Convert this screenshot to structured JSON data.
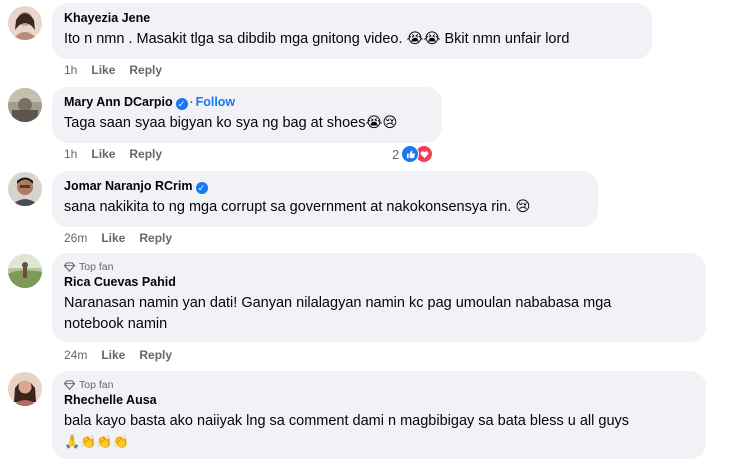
{
  "comments": [
    {
      "name": "Khayezia Jene",
      "text": "Ito n nmn . Masakit tlga sa dibdib mga gnitong video. 😭😭 Bkit nmn unfair lord",
      "time": "1h",
      "like": "Like",
      "reply": "Reply"
    },
    {
      "name": "Mary Ann DCarpio",
      "verified": true,
      "follow": "Follow",
      "text": "Taga saan syaa bigyan ko sya ng bag at shoes😭😢",
      "time": "1h",
      "like": "Like",
      "reply": "Reply",
      "reaction_count": "2"
    },
    {
      "name": "Jomar Naranjo RCrim",
      "verified": true,
      "text": "sana nakikita to ng mga corrupt sa government at nakokonsensya rin. 😢",
      "time": "26m",
      "like": "Like",
      "reply": "Reply"
    },
    {
      "badge": "Top fan",
      "name": "Rica Cuevas Pahid",
      "text_line1": "Naranasan namin yan dati! Ganyan nilalagyan namin kc pag umoulan nababasa mga",
      "text_line2": "notebook namin",
      "time": "24m",
      "like": "Like",
      "reply": "Reply"
    },
    {
      "badge": "Top fan",
      "name": "Rhechelle Ausa",
      "text_line1": "bala kayo basta ako naiiyak lng sa comment dami n magbibigay sa bata bless u all guys",
      "text_line2": "🙏👏👏👏"
    }
  ],
  "icons": {
    "avatar_colors": [
      "#d9b8a8",
      "#8e8a7c",
      "#6b5a4e",
      "#9ab07c",
      "#c79a86"
    ],
    "like_color": "#1877f2",
    "love_color": "#f33e58"
  }
}
